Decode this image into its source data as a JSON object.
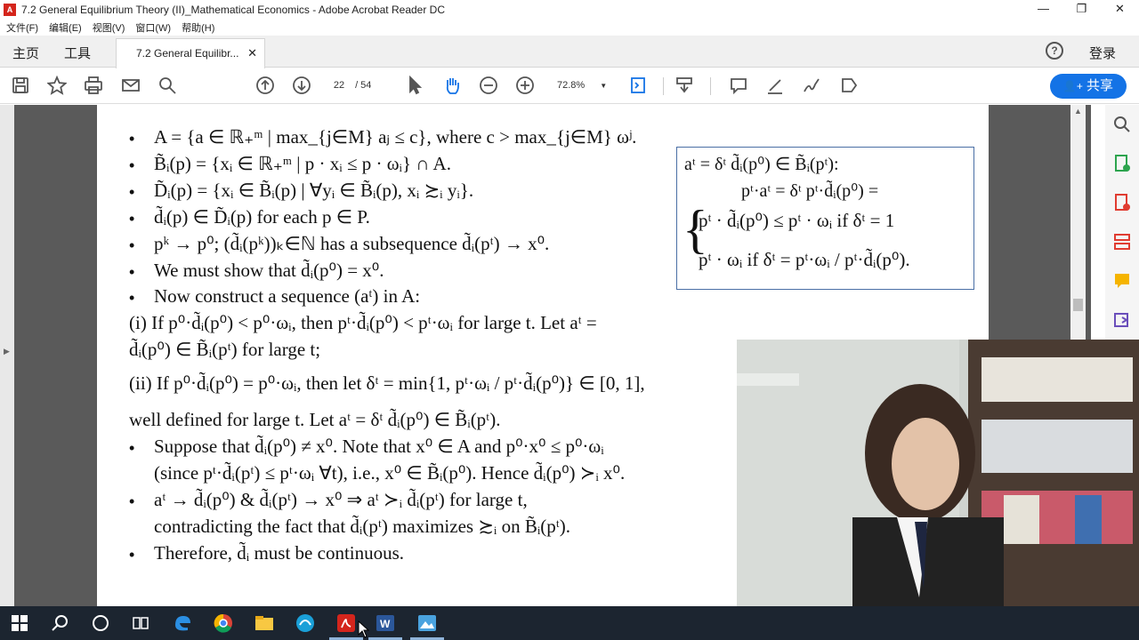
{
  "window": {
    "title": "7.2 General Equilibrium Theory (II)_Mathematical Economics - Adobe Acrobat Reader DC",
    "app_icon": "pdf-icon",
    "minimize": "—",
    "restore": "❐",
    "close": "✕"
  },
  "menu": [
    "文件(F)",
    "编辑(E)",
    "视图(V)",
    "窗口(W)",
    "帮助(H)"
  ],
  "tabs": {
    "home": "主页",
    "tools": "工具",
    "document": "7.2 General Equilibr...",
    "close": "✕",
    "login": "登录",
    "help": "?"
  },
  "toolbar": {
    "page_current": "22",
    "page_total": "/ 54",
    "zoom": "72.8%",
    "share": "共享"
  },
  "content": {
    "lines": [
      "A = {a ∈ ℝ₊ᵐ | max_{j∈M} aⱼ ≤ c}, where c > max_{j∈M} ωʲ.",
      "B̃ᵢ(p) = {xᵢ ∈ ℝ₊ᵐ | p · xᵢ ≤ p · ωᵢ} ∩ A.",
      "D̃ᵢ(p) = {xᵢ ∈ B̃ᵢ(p) | ∀yᵢ ∈ B̃ᵢ(p), xᵢ ≿ᵢ yᵢ}.",
      "d̃ᵢ(p) ∈ D̃ᵢ(p) for each p ∈ P.",
      "pᵏ → p⁰; (d̃ᵢ(pᵏ))ₖ∈ℕ has a subsequence d̃ᵢ(pᵗ) → x⁰.",
      "We must show that d̃ᵢ(p⁰) = x⁰.",
      "Now construct a sequence (aᵗ) in A:",
      "(i) If p⁰·d̃ᵢ(p⁰) < p⁰·ωᵢ, then pᵗ·d̃ᵢ(p⁰) < pᵗ·ωᵢ for large t. Let aᵗ =",
      "d̃ᵢ(p⁰) ∈ B̃ᵢ(pᵗ) for large t;",
      "(ii) If p⁰·d̃ᵢ(p⁰) = p⁰·ωᵢ, then let δᵗ = min{1, pᵗ·ωᵢ / pᵗ·d̃ᵢ(p⁰)} ∈ [0, 1],",
      "well defined for large t. Let aᵗ = δᵗ d̃ᵢ(p⁰) ∈ B̃ᵢ(pᵗ).",
      "Suppose that d̃ᵢ(p⁰) ≠ x⁰. Note that x⁰ ∈ A and p⁰·x⁰ ≤ p⁰·ωᵢ",
      "(since pᵗ·d̃ᵢ(pᵗ) ≤ pᵗ·ωᵢ ∀t), i.e., x⁰ ∈ B̃ᵢ(p⁰). Hence d̃ᵢ(p⁰) ≻ᵢ x⁰.",
      "aᵗ → d̃ᵢ(p⁰) & d̃ᵢ(pᵗ) → x⁰  ⇒ aᵗ ≻ᵢ d̃ᵢ(pᵗ) for large t,",
      "contradicting the fact that d̃ᵢ(pᵗ) maximizes ≿ᵢ on B̃ᵢ(pᵗ).",
      "Therefore, d̃ᵢ must be continuous."
    ],
    "box": {
      "l1": "aᵗ = δᵗ d̃ᵢ(p⁰) ∈ B̃ᵢ(pᵗ):",
      "l2": "pᵗ·aᵗ = δᵗ pᵗ·d̃ᵢ(p⁰) =",
      "l3": "pᵗ · d̃ᵢ(p⁰) ≤ pᵗ · ωᵢ if δᵗ = 1",
      "l4": "pᵗ · ωᵢ          if δᵗ = pᵗ·ωᵢ / pᵗ·d̃ᵢ(p⁰)."
    }
  },
  "taskbar": {
    "icons": [
      "windows-start-icon",
      "search-icon",
      "cortana-icon",
      "task-view-icon",
      "edge-icon",
      "chrome-icon",
      "file-explorer-icon",
      "app-icon",
      "acrobat-icon",
      "word-icon",
      "photos-icon"
    ]
  }
}
